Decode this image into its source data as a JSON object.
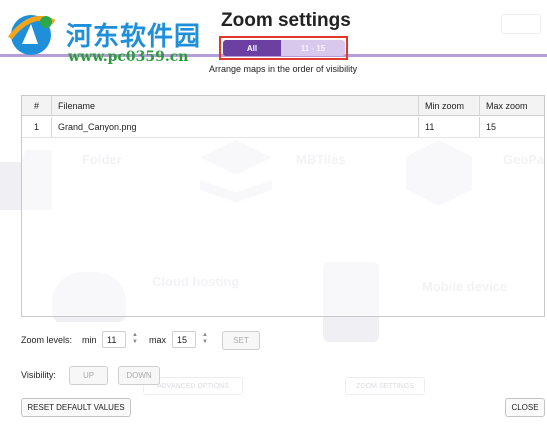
{
  "watermark": {
    "site_name": "河东软件园",
    "url": "www.pc0359.cn"
  },
  "dialog": {
    "title": "Zoom settings",
    "tabs": [
      {
        "label": "All",
        "active": true
      },
      {
        "label": "11 - 15",
        "active": false
      }
    ],
    "subtitle": "Arrange maps in the order of visibility"
  },
  "table": {
    "columns": [
      "#",
      "Filename",
      "Min zoom",
      "Max zoom"
    ],
    "rows": [
      {
        "index": "1",
        "filename": "Grand_Canyon.png",
        "min_zoom": "11",
        "max_zoom": "15"
      }
    ]
  },
  "zoom_levels": {
    "label": "Zoom levels:",
    "min_label": "min",
    "min_value": "11",
    "max_label": "max",
    "max_value": "15",
    "set_label": "SET"
  },
  "visibility": {
    "label": "Visibility:",
    "up_label": "UP",
    "down_label": "DOWN"
  },
  "footer": {
    "reset_label": "RESET DEFAULT VALUES",
    "close_label": "CLOSE"
  },
  "background": {
    "tiles": [
      "Folder",
      "MBTiles",
      "GeoPa",
      "Cloud hosting",
      "Mobile device"
    ],
    "buttons": [
      "ADVANCED OPTIONS",
      "ZOOM SETTINGS"
    ]
  },
  "colors": {
    "accent": "#6c3fa3",
    "accent_light": "#d8c9ec",
    "highlight": "#e0392b"
  }
}
